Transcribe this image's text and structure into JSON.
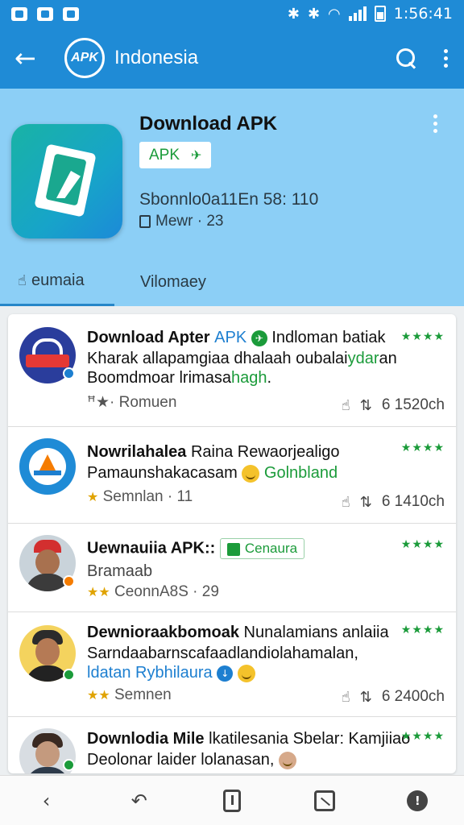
{
  "status_bar": {
    "time": "1:56:41"
  },
  "app_bar": {
    "title": "Indonesia",
    "logo_text": "APK",
    "icons": [
      "back-arrow-icon",
      "search-icon",
      "overflow-menu-icon"
    ]
  },
  "hero": {
    "title": "Download APK",
    "badge_label": "APK",
    "meta": "Sbonnlo0a11En 58: 110",
    "sub": "Mewr · 23",
    "tabs": [
      {
        "label": "eumaia"
      },
      {
        "label": "Vilomaey"
      }
    ]
  },
  "feed": [
    {
      "title": "Download Apter",
      "title_hl": "APK",
      "title_rest": "Indloman batiak",
      "line2": "Kharak allapamgiaa dhalaah oubalai",
      "line2_green": "ydar",
      "line2_tail": "an",
      "line3": "Boomdmoar lrimasa",
      "line3_green": "hagh",
      "line3_tail": ".",
      "rating": "★★★★",
      "meta_left": "ꟸ★· Romuen",
      "meta_count": "6 1520ch",
      "avatar_color": "#2a3d9c"
    },
    {
      "title": "Nowrilahalea",
      "title_rest": "Raina Rewaorjealigo",
      "line2": "Pamaunshakacasam",
      "line2_green": "Golnbland",
      "rating": "★★★★",
      "meta_stars": "★",
      "meta_left": "Semnlan · 11",
      "meta_count": "6 1410ch",
      "avatar_color": "#1f8bd6"
    },
    {
      "title": "Uewnauiia APK::",
      "chip_label": "Cenaura",
      "line2": "Bramaab",
      "rating": "★★★★",
      "meta_stars": "★★",
      "meta_left": "CeonnA8S · 29",
      "avatar_color": "#8a5a3c"
    },
    {
      "title": "Dewnioraakbomoak",
      "title_rest": "Nunalamians anlaiia",
      "line2": "Sarndaabarnscafaadlandiolahamalan,",
      "line3_blue": "ldatan Rybhilaura",
      "rating": "★★★★",
      "meta_stars": "★★",
      "meta_left": "Semnen",
      "meta_count": "6 2400ch",
      "avatar_color": "#b57a55"
    },
    {
      "title": "Downlodia Mile",
      "title_rest": "lkatilesania Sbelar: Kamjiiao",
      "line2": "Deolonar laider lolanasan,",
      "rating": "★★★★",
      "avatar_color": "#7a6a60"
    }
  ],
  "bottom_nav": {
    "icons": [
      "back-chevron-icon",
      "return-icon",
      "document-icon",
      "image-icon",
      "info-icon"
    ]
  },
  "colors": {
    "app_bar": "#1f8bd6",
    "hero_bg": "#8ccff6",
    "accent_green": "#1b9b3a",
    "accent_blue": "#1d7fd0"
  }
}
